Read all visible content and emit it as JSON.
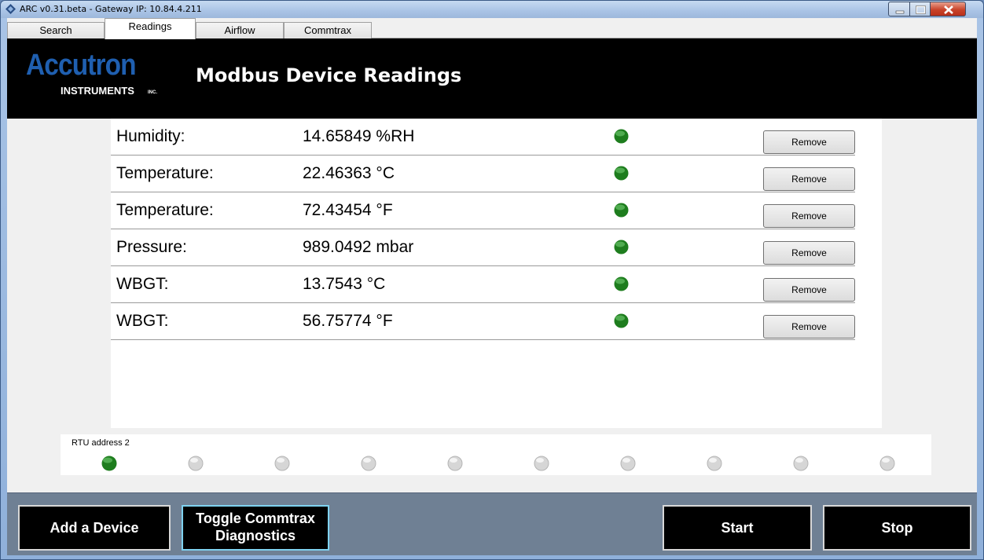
{
  "window": {
    "title": "ARC v0.31.beta - Gateway IP: 10.84.4.211"
  },
  "tabs": [
    {
      "label": "Search"
    },
    {
      "label": "Readings"
    },
    {
      "label": "Airflow"
    },
    {
      "label": "Commtrax"
    }
  ],
  "active_tab": "Readings",
  "banner": {
    "logo_main": "Accutron",
    "logo_sub": "INSTRUMENTS",
    "logo_inc": "INC.",
    "title": "Modbus Device Readings"
  },
  "readings": [
    {
      "label": "Humidity:",
      "value": "14.65849 %RH",
      "status": "green",
      "remove_label": "Remove"
    },
    {
      "label": "Temperature:",
      "value": "22.46363 °C",
      "status": "green",
      "remove_label": "Remove"
    },
    {
      "label": "Temperature:",
      "value": "72.43454 °F",
      "status": "green",
      "remove_label": "Remove"
    },
    {
      "label": "Pressure:",
      "value": "989.0492 mbar",
      "status": "green",
      "remove_label": "Remove"
    },
    {
      "label": "WBGT:",
      "value": "13.7543 °C",
      "status": "green",
      "remove_label": "Remove"
    },
    {
      "label": "WBGT:",
      "value": "56.75774 °F",
      "status": "green",
      "remove_label": "Remove"
    }
  ],
  "rtu": {
    "label": "RTU address 2",
    "indicators": [
      "green",
      "gray",
      "gray",
      "gray",
      "gray",
      "gray",
      "gray",
      "gray",
      "gray",
      "gray"
    ]
  },
  "buttons": {
    "add_device": "Add a Device",
    "toggle_line1": "Toggle Commtrax",
    "toggle_line2": "Diagnostics",
    "start": "Start",
    "stop": "Stop"
  },
  "colors": {
    "led_green": "#1e7d1e",
    "led_gray": "#d6d6d6",
    "banner_bg": "#000000",
    "logo_blue": "#1f5fb0",
    "bottom_bar": "#6f8094",
    "toggle_border": "#7fd2f0"
  }
}
